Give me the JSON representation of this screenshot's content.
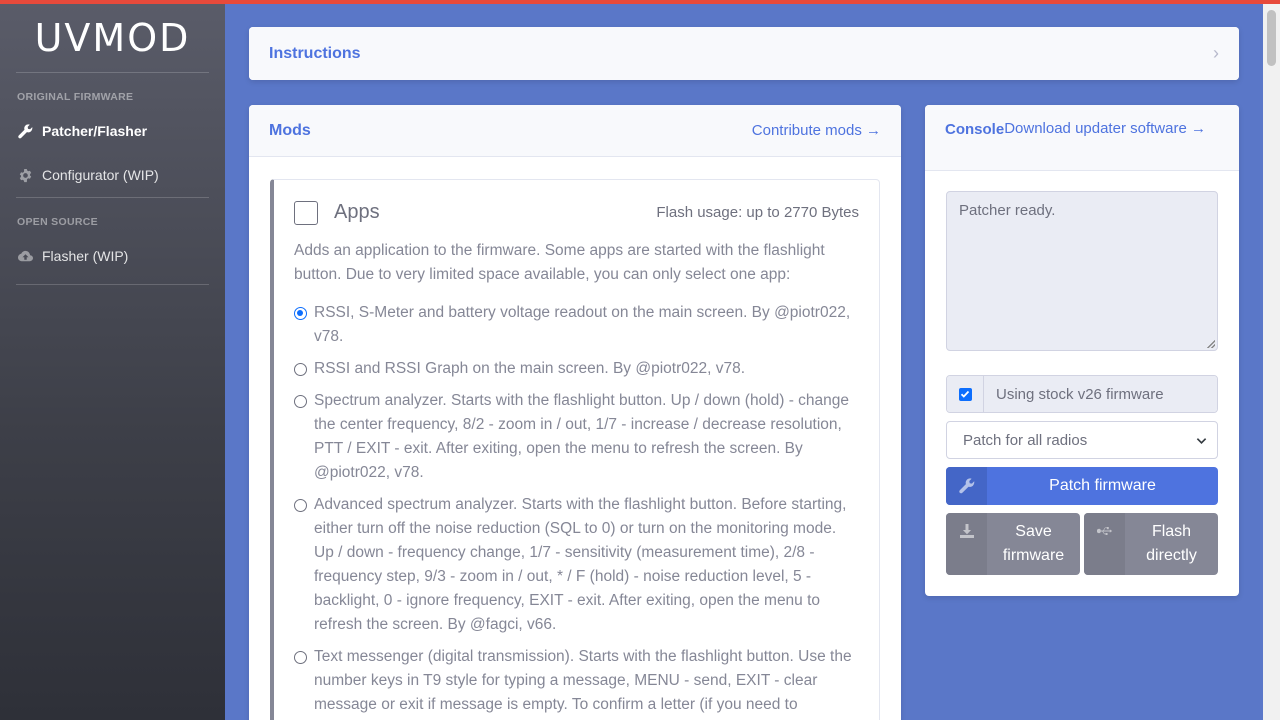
{
  "sidebar": {
    "brand": "UVMOD",
    "sections": [
      {
        "heading": "ORIGINAL FIRMWARE",
        "items": [
          {
            "label": "Patcher/Flasher",
            "icon": "wrench-icon",
            "active": true
          },
          {
            "label": "Configurator (WIP)",
            "icon": "gear-icon",
            "active": false
          }
        ]
      },
      {
        "heading": "OPEN SOURCE",
        "items": [
          {
            "label": "Flasher (WIP)",
            "icon": "cloud-upload-icon",
            "active": false
          }
        ]
      }
    ]
  },
  "instructions": {
    "title": "Instructions",
    "chevron": "›"
  },
  "mods": {
    "title": "Mods",
    "contribute_link": "Contribute mods →",
    "apps": {
      "title": "Apps",
      "flash_usage": "Flash usage: up to 2770 Bytes",
      "description": "Adds an application to the firmware. Some apps are started with the flashlight button. Due to very limited space available, you can only select one app:",
      "options": [
        {
          "text": "RSSI, S-Meter and battery voltage readout on the main screen. By @piotr022, v78.",
          "selected": true
        },
        {
          "text": "RSSI and RSSI Graph on the main screen. By @piotr022, v78.",
          "selected": false
        },
        {
          "text": "Spectrum analyzer. Starts with the flashlight button. Up / down (hold) - change the center frequency, 8/2 - zoom in / out, 1/7 - increase / decrease resolution, PTT / EXIT - exit. After exiting, open the menu to refresh the screen. By @piotr022, v78.",
          "selected": false
        },
        {
          "text": "Advanced spectrum analyzer. Starts with the flashlight button. Before starting, either turn off the noise reduction (SQL to 0) or turn on the monitoring mode. Up / down - frequency change, 1/7 - sensitivity (measurement time), 2/8 - frequency step, 9/3 - zoom in / out, * / F (hold) - noise reduction level, 5 - backlight, 0 - ignore frequency, EXIT - exit. After exiting, open the menu to refresh the screen. By @fagci, v66.",
          "selected": false
        },
        {
          "text": "Text messenger (digital transmission). Starts with the flashlight button. Use the number keys in T9 style for typing a message, MENU - send, EXIT - clear message or exit if message is empty. To confirm a letter (if you need to",
          "selected": false
        }
      ]
    }
  },
  "console": {
    "title": "Console",
    "download_link": "Download updater software →",
    "log_text": "Patcher ready.",
    "stock_firmware_label": "Using stock v26 firmware",
    "stock_firmware_checked": true,
    "patch_select_value": "Patch for all radios",
    "patch_button": "Patch firmware",
    "save_button": "Save firmware",
    "flash_button": "Flash directly"
  },
  "colors": {
    "primary": "#4e73df",
    "secondary": "#858796",
    "topbar": "#e74a3b",
    "background": "#5a77c8"
  }
}
